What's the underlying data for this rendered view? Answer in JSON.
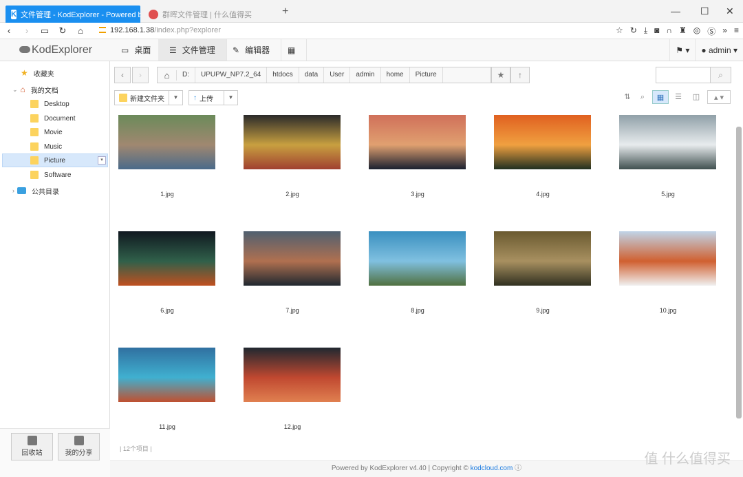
{
  "browser": {
    "tab_active": "文件管理 - KodExplorer - Powered by",
    "tab_icon": "K",
    "tab_inactive": "群晖文件管理 | 什么值得买",
    "new_tab": "+",
    "url_host": "192.168.1.38",
    "url_path": "/index.php?explorer"
  },
  "app": {
    "logo": "KodExplorer",
    "top_tabs": [
      "桌面",
      "文件管理",
      "编辑器"
    ],
    "user": "admin"
  },
  "sidebar": {
    "favorites": "收藏夹",
    "my_docs": "我的文档",
    "folders": [
      "Desktop",
      "Document",
      "Movie",
      "Music",
      "Picture",
      "Software"
    ],
    "public": "公共目录",
    "recycle": "回收站",
    "share": "我的分享"
  },
  "path": {
    "crumbs": [
      "D:",
      "UPUPW_NP7.2_64",
      "htdocs",
      "data",
      "User",
      "admin",
      "home",
      "Picture"
    ]
  },
  "toolbar": {
    "new_folder": "新建文件夹",
    "upload": "上传"
  },
  "files": [
    {
      "name": "1.jpg",
      "c1": "#6b8a5a",
      "c2": "#a08870",
      "c3": "#4a6a8a"
    },
    {
      "name": "2.jpg",
      "c1": "#2a2a2a",
      "c2": "#c8a040",
      "c3": "#a04030"
    },
    {
      "name": "3.jpg",
      "c1": "#d0705a",
      "c2": "#e0a070",
      "c3": "#1a2030"
    },
    {
      "name": "4.jpg",
      "c1": "#e06020",
      "c2": "#f0a040",
      "c3": "#203020"
    },
    {
      "name": "5.jpg",
      "c1": "#90a0a8",
      "c2": "#e8ecee",
      "c3": "#405050"
    },
    {
      "name": "6.jpg",
      "c1": "#101820",
      "c2": "#30604a",
      "c3": "#c05020"
    },
    {
      "name": "7.jpg",
      "c1": "#506070",
      "c2": "#b07050",
      "c3": "#202830"
    },
    {
      "name": "8.jpg",
      "c1": "#3a90c0",
      "c2": "#80c0e0",
      "c3": "#507040"
    },
    {
      "name": "9.jpg",
      "c1": "#6a5a30",
      "c2": "#a89060",
      "c3": "#303020"
    },
    {
      "name": "10.jpg",
      "c1": "#c0d4e8",
      "c2": "#d06030",
      "c3": "#f0f0f0"
    },
    {
      "name": "11.jpg",
      "c1": "#3070a0",
      "c2": "#40b0d0",
      "c3": "#c05030"
    },
    {
      "name": "12.jpg",
      "c1": "#202830",
      "c2": "#c04830",
      "c3": "#e08050"
    }
  ],
  "status": {
    "count": "12个项目"
  },
  "footer": {
    "text": "Powered by KodExplorer v4.40 | Copyright ©",
    "link": "kodcloud.com"
  },
  "watermark": "值 什么值得买"
}
